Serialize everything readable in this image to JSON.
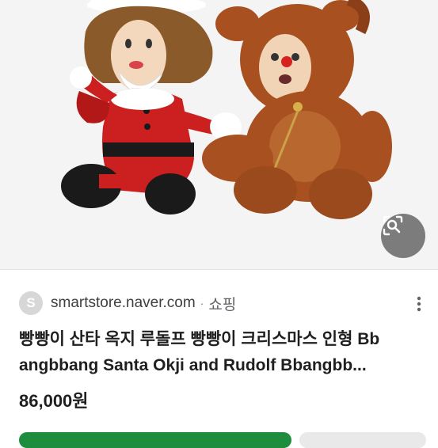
{
  "result": {
    "favicon_letter": "S",
    "domain": "smartstore.naver.com",
    "separator": "·",
    "category": "쇼핑",
    "title_line1": "빵빵이 산타 옥지 루돌프 빵빵이 크리스마스 인형 Bb",
    "title_line2": "angbbang Santa Okji and Rudolf Bbangbb...",
    "price": "86,000원"
  },
  "icons": {
    "lens": "google-lens-icon",
    "more": "more-vert-icon"
  },
  "colors": {
    "primary_button": "#1e8e3e",
    "secondary_button": "#e9e9e9",
    "santa_red": "#cc1f1f",
    "reindeer_brown": "#a8501f"
  }
}
